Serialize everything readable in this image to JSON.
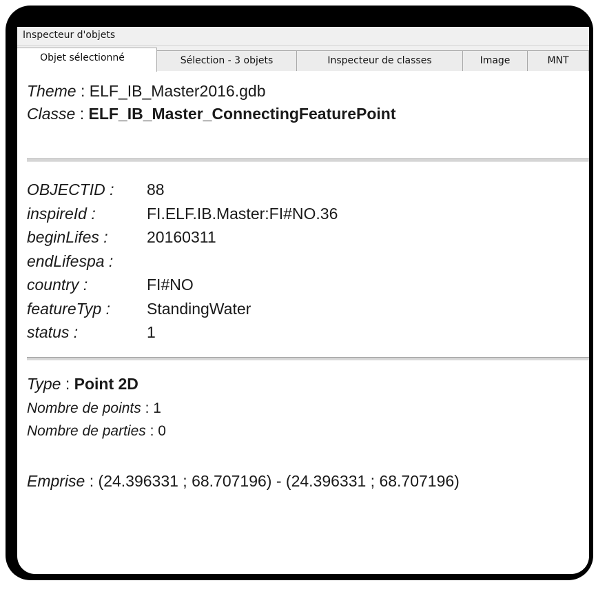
{
  "window": {
    "title": "Inspecteur d'objets"
  },
  "tabs": [
    {
      "label": "Objet sélectionné",
      "active": true
    },
    {
      "label": "Sélection - 3 objets",
      "active": false
    },
    {
      "label": "Inspecteur de classes",
      "active": false
    },
    {
      "label": "Image",
      "active": false
    },
    {
      "label": "MNT",
      "active": false
    }
  ],
  "header": {
    "theme_key": "Theme",
    "theme_value": "ELF_IB_Master2016.gdb",
    "classe_key": "Classe",
    "classe_value": "ELF_IB_Master_ConnectingFeaturePoint"
  },
  "attributes": [
    {
      "key": "OBJECTID :",
      "value": "88"
    },
    {
      "key": "inspireId :",
      "value": "FI.ELF.IB.Master:FI#NO.36"
    },
    {
      "key": "beginLifes :",
      "value": "20160311"
    },
    {
      "key": "endLifespa :",
      "value": ""
    },
    {
      "key": "country :",
      "value": "FI#NO"
    },
    {
      "key": "featureTyp :",
      "value": "StandingWater"
    },
    {
      "key": "status :",
      "value": "1"
    }
  ],
  "geometry": {
    "type_key": "Type",
    "type_value": "Point 2D",
    "points_key": "Nombre de points",
    "points_value": "1",
    "parts_key": "Nombre de parties",
    "parts_value": "0",
    "extent_key": "Emprise",
    "extent_value": "(24.396331 ; 68.707196) - (24.396331 ; 68.707196)"
  }
}
